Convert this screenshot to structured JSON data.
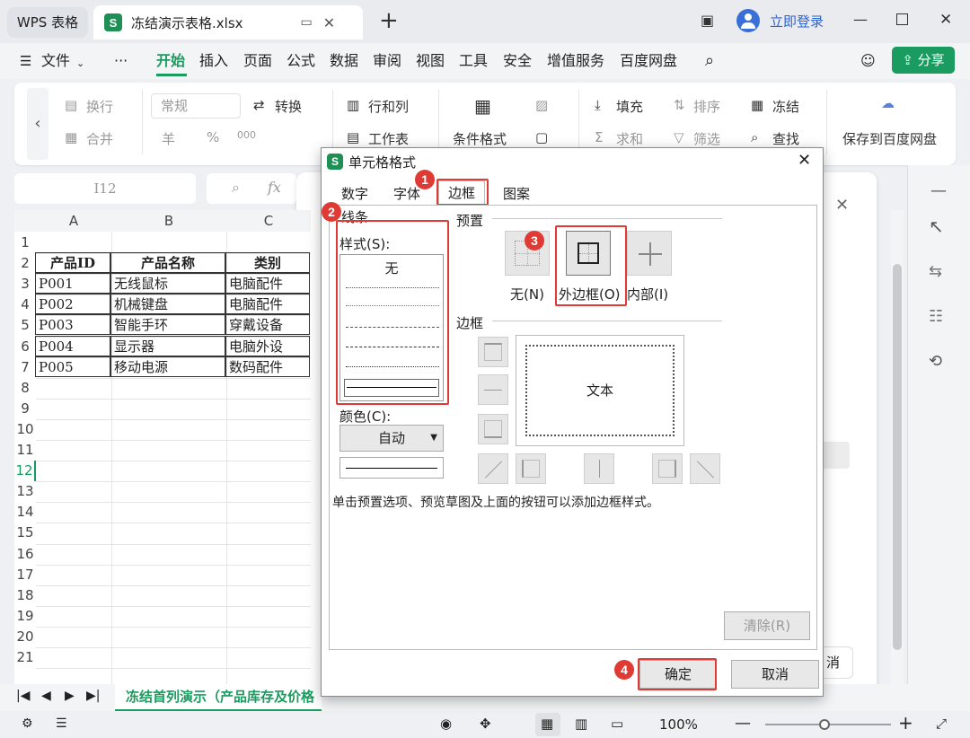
{
  "titlebar": {
    "home_tab": "WPS 表格",
    "file_tab": "冻结演示表格.xlsx",
    "app_icon": "S",
    "login": "立即登录"
  },
  "menubar": {
    "items": [
      "文件",
      "···",
      "开始",
      "插入",
      "页面",
      "公式",
      "数据",
      "审阅",
      "视图",
      "工具",
      "安全",
      "增值服务",
      "百度网盘"
    ],
    "share": "分享",
    "active_color": "#1a9b5f"
  },
  "ribbon": {
    "wrap": "换行",
    "merge": "合并",
    "format_select": "常规",
    "convert": "转换",
    "row_col": "行和列",
    "worksheet": "工作表",
    "cond_format": "条件格式",
    "fill": "填充",
    "sort": "排序",
    "freeze": "冻结",
    "sum": "求和",
    "filter": "筛选",
    "find": "查找",
    "save_baidu": "保存到百度网盘",
    "currency": "羊",
    "percent": "%",
    "thousands": "000"
  },
  "formula": {
    "cell_ref": "I12",
    "fx": "fx"
  },
  "sheet": {
    "columns": [
      "A",
      "B",
      "C"
    ],
    "rows": [
      "1",
      "2",
      "3",
      "4",
      "5",
      "6",
      "7",
      "8",
      "9",
      "10",
      "11",
      "12",
      "13",
      "14",
      "15",
      "16",
      "17",
      "18",
      "19",
      "20",
      "21"
    ],
    "header": [
      "产品ID",
      "产品名称",
      "类别"
    ],
    "data": [
      [
        "P001",
        "无线鼠标",
        "电脑配件"
      ],
      [
        "P002",
        "机械键盘",
        "电脑配件"
      ],
      [
        "P003",
        "智能手环",
        "穿戴设备"
      ],
      [
        "P004",
        "显示器",
        "电脑外设"
      ],
      [
        "P005",
        "移动电源",
        "数码配件"
      ]
    ]
  },
  "sheet_tabs": {
    "active": "冻结首列演示（产品库存及价格"
  },
  "status": {
    "zoom": "100%"
  },
  "dialog": {
    "title": "单元格格式",
    "tabs": [
      "数字",
      "字体",
      "边框",
      "图案"
    ],
    "line_group": "线条",
    "style_label": "样式(S):",
    "style_none": "无",
    "color_label": "颜色(C):",
    "color_value": "自动",
    "preset_group": "预置",
    "preset_none": "无(N)",
    "preset_outline": "外边框(O)",
    "preset_inside": "内部(I)",
    "border_group": "边框",
    "preview_text": "文本",
    "hint": "单击预置选项、预览草图及上面的按钮可以添加边框样式。",
    "clear": "清除(R)",
    "ok": "确定",
    "cancel": "取消"
  },
  "annotations": [
    "1",
    "2",
    "3",
    "4"
  ],
  "background_panel": {
    "cancel_fragment": "消"
  }
}
